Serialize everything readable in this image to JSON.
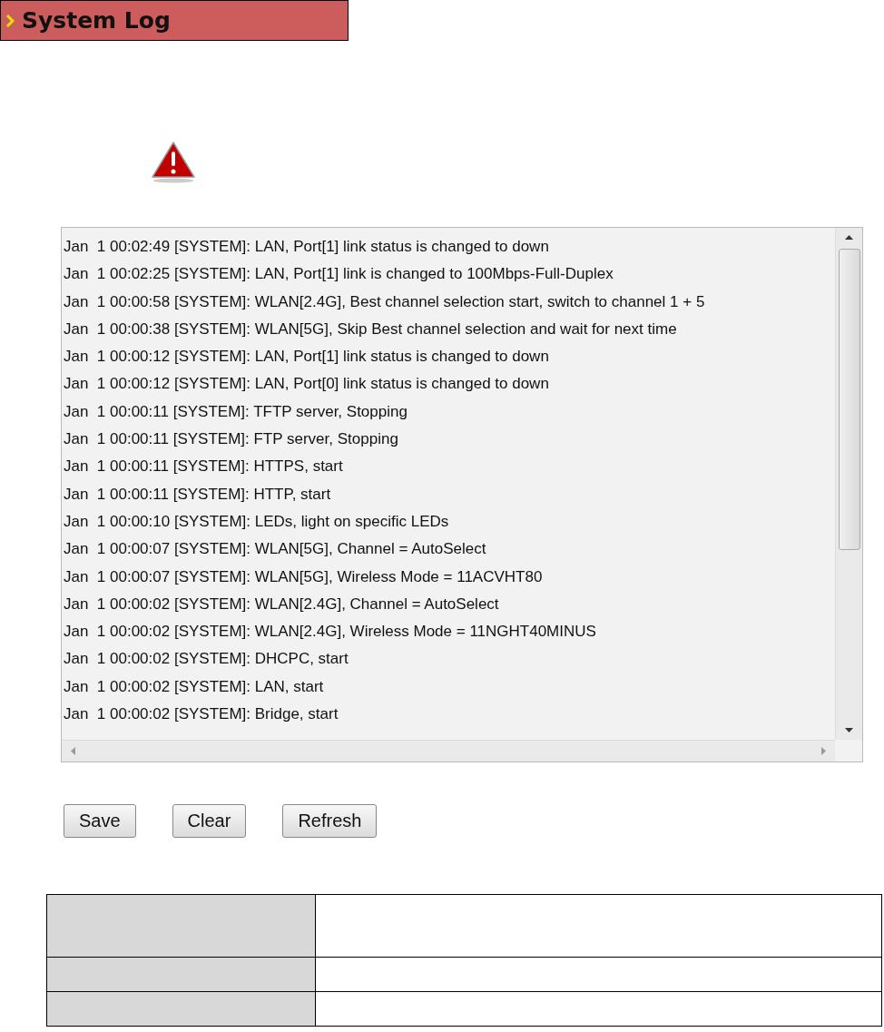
{
  "header": {
    "title": "System Log"
  },
  "log": {
    "lines": [
      "Jan  1 00:02:49 [SYSTEM]: LAN, Port[1] link status is changed to down",
      "Jan  1 00:02:25 [SYSTEM]: LAN, Port[1] link is changed to 100Mbps-Full-Duplex",
      "Jan  1 00:00:58 [SYSTEM]: WLAN[2.4G], Best channel selection start, switch to channel 1 + 5",
      "Jan  1 00:00:38 [SYSTEM]: WLAN[5G], Skip Best channel selection and wait for next time",
      "Jan  1 00:00:12 [SYSTEM]: LAN, Port[1] link status is changed to down",
      "Jan  1 00:00:12 [SYSTEM]: LAN, Port[0] link status is changed to down",
      "Jan  1 00:00:11 [SYSTEM]: TFTP server, Stopping",
      "Jan  1 00:00:11 [SYSTEM]: FTP server, Stopping",
      "Jan  1 00:00:11 [SYSTEM]: HTTPS, start",
      "Jan  1 00:00:11 [SYSTEM]: HTTP, start",
      "Jan  1 00:00:10 [SYSTEM]: LEDs, light on specific LEDs",
      "Jan  1 00:00:07 [SYSTEM]: WLAN[5G], Channel = AutoSelect",
      "Jan  1 00:00:07 [SYSTEM]: WLAN[5G], Wireless Mode = 11ACVHT80",
      "Jan  1 00:00:02 [SYSTEM]: WLAN[2.4G], Channel = AutoSelect",
      "Jan  1 00:00:02 [SYSTEM]: WLAN[2.4G], Wireless Mode = 11NGHT40MINUS",
      "Jan  1 00:00:02 [SYSTEM]: DHCPC, start",
      "Jan  1 00:00:02 [SYSTEM]: LAN, start",
      "Jan  1 00:00:02 [SYSTEM]: Bridge, start"
    ]
  },
  "buttons": [
    "Save",
    "Clear",
    "Refresh"
  ]
}
